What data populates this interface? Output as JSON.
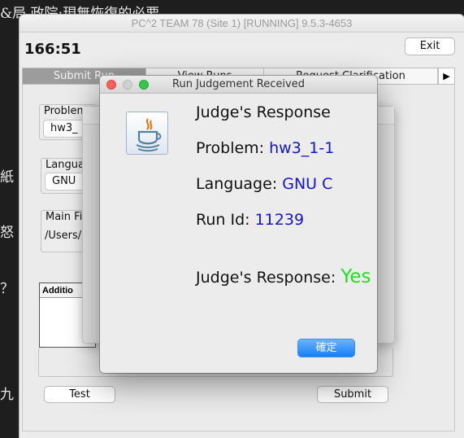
{
  "background": {
    "lines": [
      "&局 政院:現無恢復的必要",
      "紙",
      "怒",
      "？",
      "九"
    ]
  },
  "main_window": {
    "title": "PC^2 TEAM 78 (Site 1) [RUNNING] 9.5.3-4653",
    "clock": "166:51",
    "exit_label": "Exit",
    "tabs": [
      "Submit Run",
      "View Runs",
      "Request Clarification"
    ],
    "tab_scroll": "▶",
    "problem_label": "Problem",
    "problem_value": "hw3_",
    "language_label": "Langua",
    "language_value": "GNU",
    "main_file_label": "Main Fi",
    "main_file_value": "/Users/",
    "additional_label": "Additio",
    "test_label": "Test",
    "submit_label": "Submit"
  },
  "dialog": {
    "title": "Run Judgement Received",
    "heading": "Judge's Response",
    "problem_label": "Problem:",
    "problem_value": "hw3_1-1",
    "language_label": "Language:",
    "language_value": "GNU C",
    "runid_label": "Run Id:",
    "runid_value": "11239",
    "response_label": "Judge's Response:",
    "response_value": "Yes",
    "ok_label": "確定"
  },
  "colors": {
    "value_blue": "#1414c8",
    "yes_green": "#1ee01e",
    "ok_button": "#157efb"
  }
}
